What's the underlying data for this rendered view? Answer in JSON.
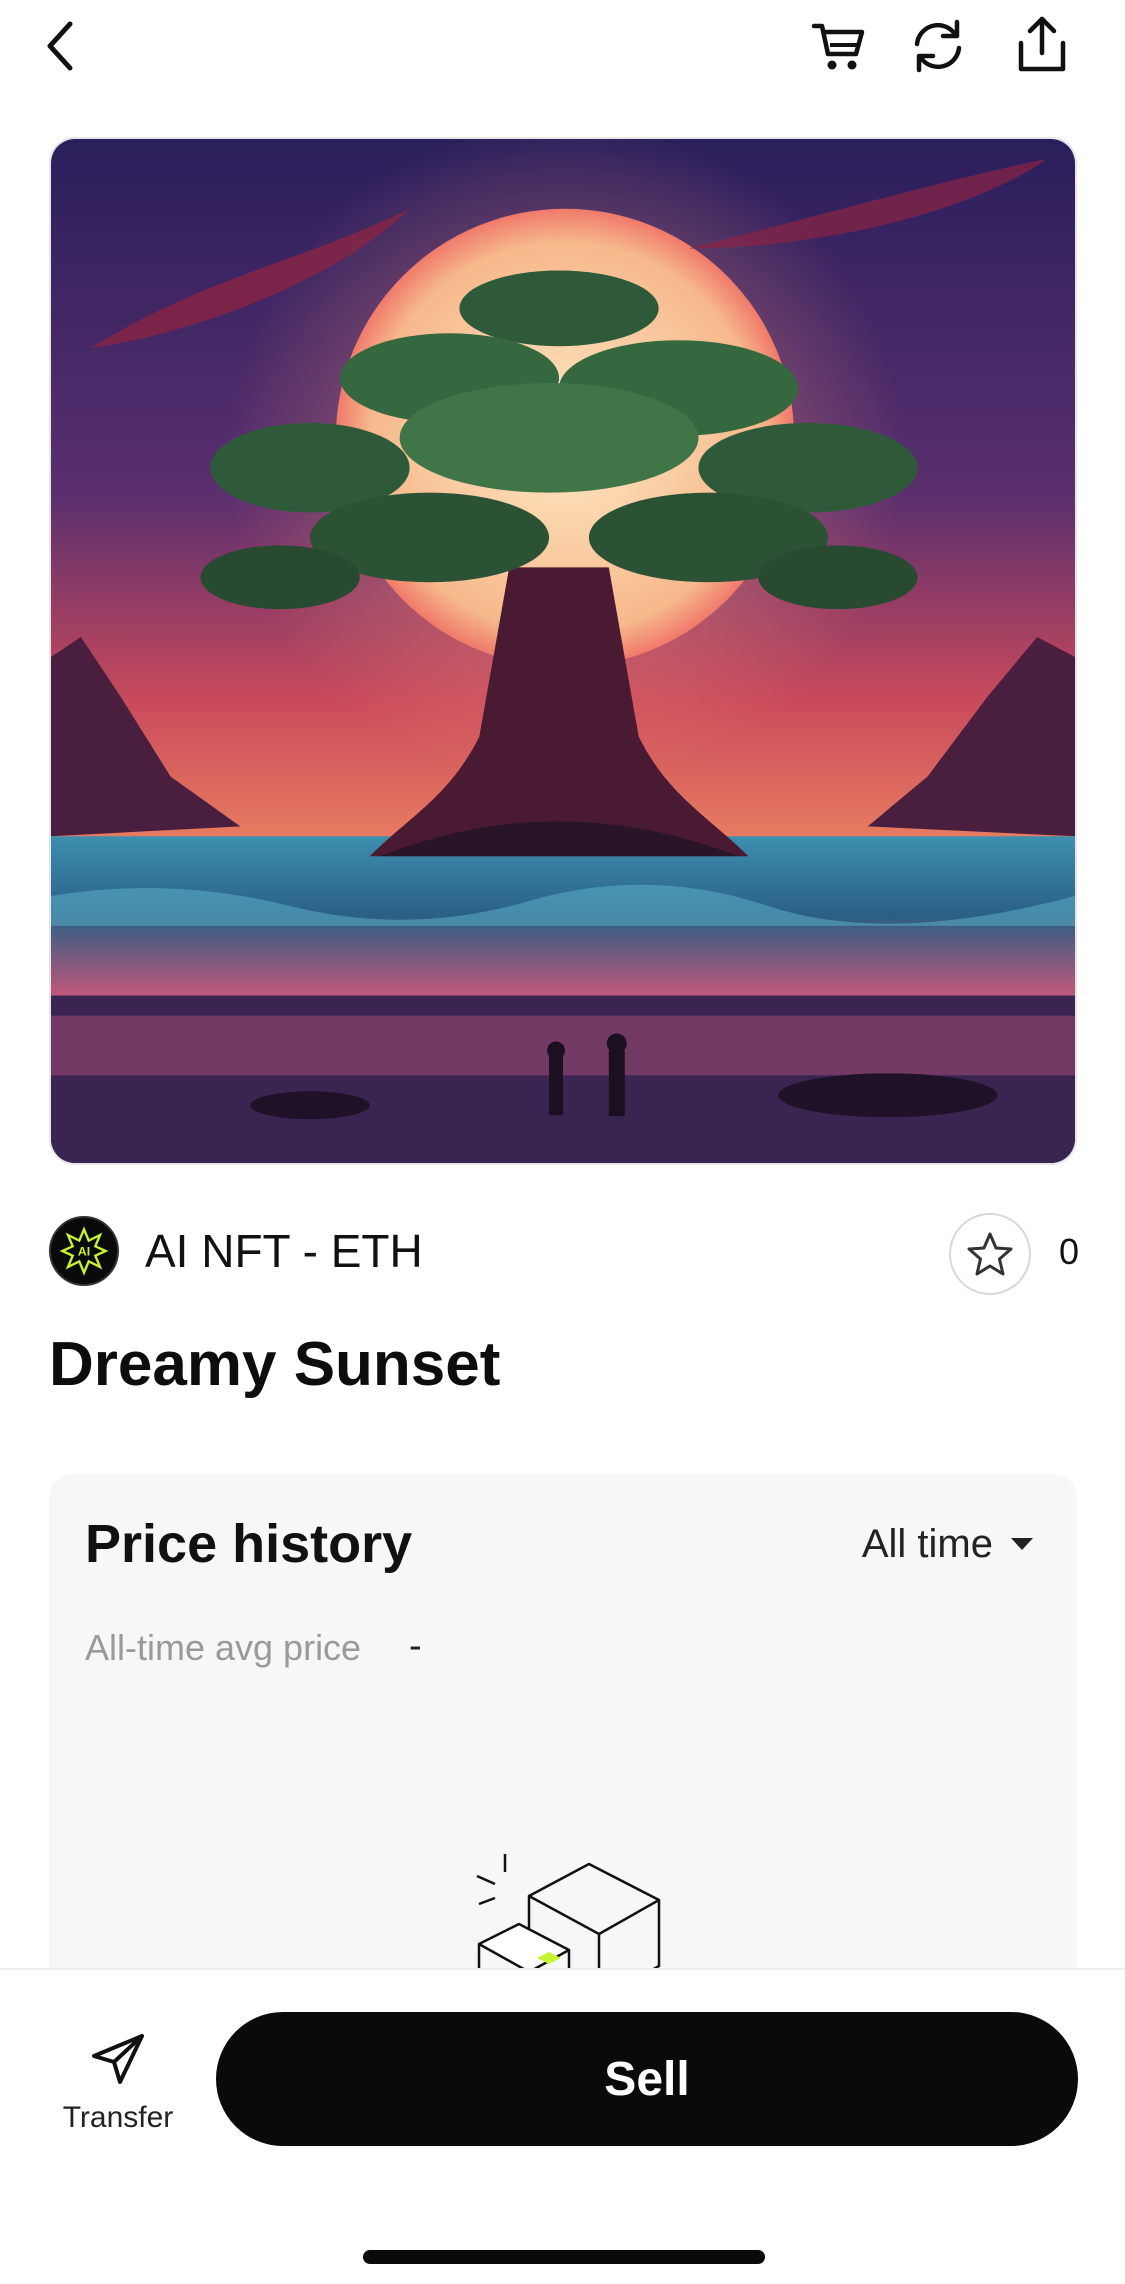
{
  "collection": {
    "name": "AI NFT - ETH",
    "avatar_text": "AI"
  },
  "favorites": {
    "count": "0"
  },
  "nft": {
    "title": "Dreamy Sunset"
  },
  "price_history": {
    "title": "Price history",
    "range": "All time",
    "avg_label": "All-time avg price",
    "avg_value": "-"
  },
  "actions": {
    "transfer_label": "Transfer",
    "sell_label": "Sell"
  },
  "icons": {
    "back": "chevron-left-icon",
    "cart": "cart-icon",
    "refresh": "refresh-icon",
    "share": "share-icon",
    "favorite": "star-icon",
    "transfer": "paper-plane-icon"
  },
  "colors": {
    "primary_button": "#0a0a0a",
    "accent_green": "#c6f432"
  }
}
